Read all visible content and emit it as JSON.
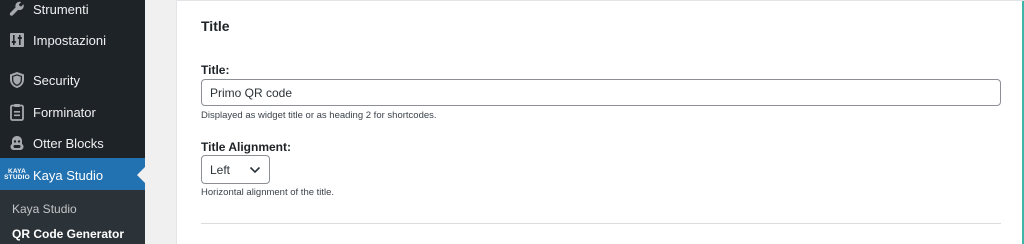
{
  "sidebar": {
    "items": [
      {
        "label": "Strumenti",
        "icon": "wrench-icon"
      },
      {
        "label": "Impostazioni",
        "icon": "settings-sliders-icon"
      },
      {
        "label": "Security",
        "icon": "shield-icon"
      },
      {
        "label": "Forminator",
        "icon": "clipboard-icon"
      },
      {
        "label": "Otter Blocks",
        "icon": "otter-icon"
      },
      {
        "label": "Kaya Studio",
        "icon": "kaya-studio-logo-icon",
        "logo_text": "KAYA STUDIO",
        "current": true
      }
    ],
    "submenu": [
      {
        "label": "Kaya Studio"
      },
      {
        "label": "QR Code Generator",
        "active": true
      }
    ]
  },
  "main": {
    "section_title": "Title",
    "title_field": {
      "label": "Title:",
      "value": "Primo QR code",
      "help": "Displayed as widget title or as heading 2 for shortcodes."
    },
    "alignment_field": {
      "label": "Title Alignment:",
      "selected": "Left",
      "help": "Horizontal alignment of the title."
    }
  },
  "colors": {
    "sidebar_bg": "#1d2327",
    "current_item_bg": "#2271b1",
    "submenu_bg": "#2c3338",
    "panel_accent": "#3fb5a8"
  }
}
